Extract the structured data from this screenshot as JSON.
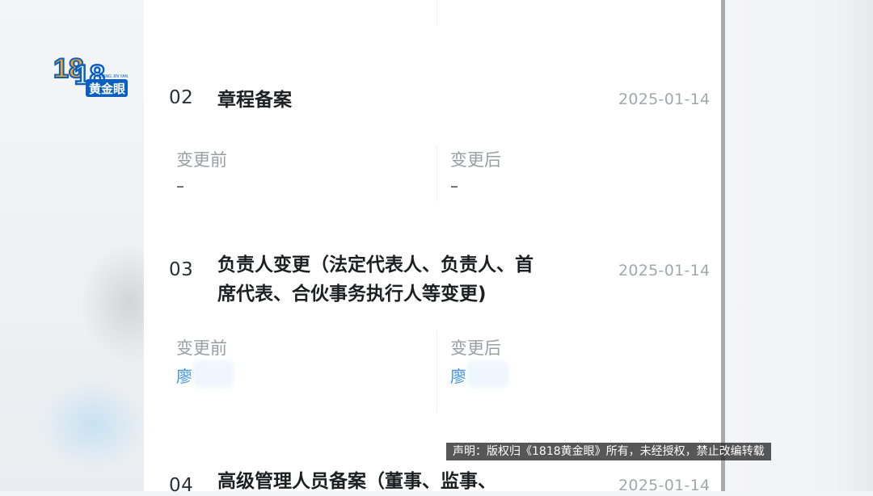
{
  "logo": {
    "digits": "1818",
    "pinyin": "HUANG JIN YAN",
    "name": "黄金眼"
  },
  "records": [
    {
      "number": "02",
      "title_lines": [
        "章程备案"
      ],
      "date": "2025-01-14",
      "before_label": "变更前",
      "before_value": "–",
      "after_label": "变更后",
      "after_value": "–"
    },
    {
      "number": "03",
      "title_lines": [
        "负责人变更（法定代表人、负责人、首",
        "席代表、合伙事务执行人等变更)"
      ],
      "date": "2025-01-14",
      "before_label": "变更前",
      "before_value": "廖",
      "after_label": "变更后",
      "after_value": "廖"
    },
    {
      "number": "04",
      "title_lines": [
        "高级管理人员备案（董事、监事、"
      ],
      "date": "2025-01-14"
    }
  ],
  "watermark": "声明：版权归《1818黄金眼》所有，未经授权，禁止改编转载",
  "colors": {
    "link_value": "#3a8fe0",
    "label": "#9a9ea4",
    "date": "#a3a7ad",
    "title": "#1d1f23"
  }
}
